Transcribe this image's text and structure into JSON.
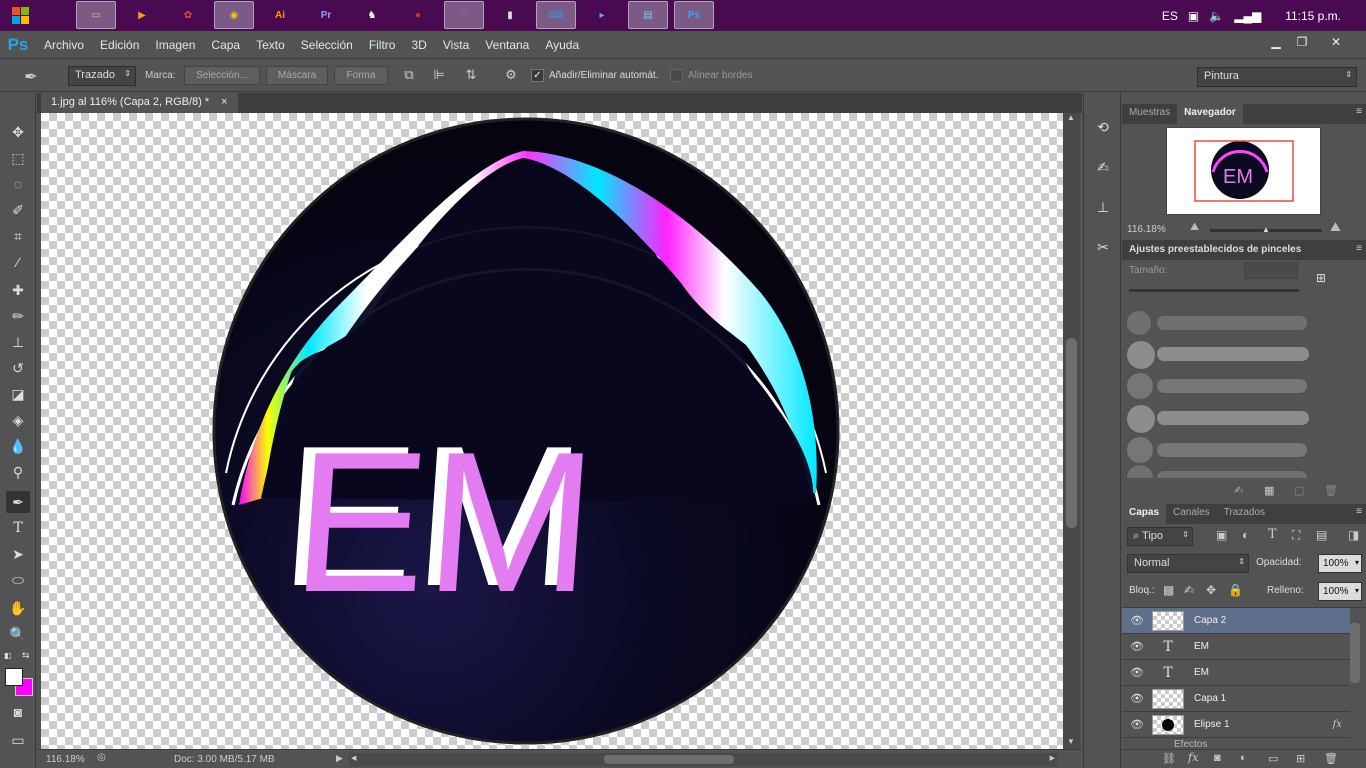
{
  "taskbar": {
    "tray": {
      "lang": "ES",
      "time": "11:15 p.m."
    },
    "apps": [
      {
        "icon": "file-explorer-icon",
        "glyph": "▭",
        "color": "#e8c36a"
      },
      {
        "icon": "media-player-icon",
        "glyph": "▶",
        "color": "#f39c12"
      },
      {
        "icon": "paint-brain-icon",
        "glyph": "✿",
        "color": "#e74c3c"
      },
      {
        "icon": "chrome-icon",
        "glyph": "◉",
        "color": "#f1c40f"
      },
      {
        "icon": "illustrator-icon",
        "glyph": "Ai",
        "color": "#ff9a00"
      },
      {
        "icon": "premiere-icon",
        "glyph": "Pr",
        "color": "#9999ff"
      },
      {
        "icon": "game-figure-icon",
        "glyph": "♞",
        "color": "#ffffff"
      },
      {
        "icon": "record-icon",
        "glyph": "●",
        "color": "#c0392b"
      },
      {
        "icon": "paint-palette-icon",
        "glyph": "✎",
        "color": "#9b59b6"
      },
      {
        "icon": "usb-icon",
        "glyph": "▮",
        "color": "#dddddd"
      },
      {
        "icon": "keyboard-icon",
        "glyph": "⌨",
        "color": "#3498db"
      },
      {
        "icon": "cmd-icon",
        "glyph": "▸",
        "color": "#5dade2"
      },
      {
        "icon": "notepad-icon",
        "glyph": "▤",
        "color": "#85c1e9"
      },
      {
        "icon": "photoshop-icon",
        "glyph": "Ps",
        "color": "#31a8ff"
      }
    ]
  },
  "app": {
    "logo": "Ps"
  },
  "menu": [
    "Archivo",
    "Edición",
    "Imagen",
    "Capa",
    "Texto",
    "Selección",
    "Filtro",
    "3D",
    "Vista",
    "Ventana",
    "Ayuda"
  ],
  "options": {
    "mode": "Trazado",
    "marca_label": "Marca:",
    "seleccion": "Selección...",
    "mascara": "Máscara",
    "forma": "Forma",
    "add_remove": "Añadir/Eliminar automát.",
    "align_edges": "Alinear bordes",
    "workspace": "Pintura"
  },
  "document": {
    "tab_title": "1.jpg al 116% (Capa 2, RGB/8) *",
    "close": "×",
    "logo_text": "EM",
    "zoom": "116.18%",
    "doc_info": "Doc: 3.00 MB/5.17 MB"
  },
  "colors": {
    "foreground": "#ffffff",
    "background": "#ff00ff",
    "accent_pink": "#e37cf0"
  },
  "navigator": {
    "tabs": [
      "Muestras",
      "Navegador"
    ],
    "active_tab": "Navegador",
    "zoom": "116.18%",
    "thumb_text": "EM"
  },
  "brush_presets": {
    "title": "Ajustes preestablecidos de pinceles",
    "size_label": "Tamaño:"
  },
  "layers_panel": {
    "tabs": [
      "Capas",
      "Canales",
      "Trazados"
    ],
    "active_tab": "Capas",
    "filter": "Tipo",
    "blend_mode": "Normal",
    "opacity_label": "Opacidad:",
    "opacity": "100%",
    "lock_label": "Bloq.:",
    "fill_label": "Relleno:",
    "fill": "100%",
    "layers": [
      {
        "name": "Capa 2",
        "kind": "raster",
        "selected": true
      },
      {
        "name": "EM",
        "kind": "text",
        "selected": false
      },
      {
        "name": "EM",
        "kind": "text",
        "selected": false
      },
      {
        "name": "Capa 1",
        "kind": "raster",
        "selected": false
      },
      {
        "name": "Elipse 1",
        "kind": "shape",
        "selected": false,
        "fx": "fx"
      }
    ],
    "effects_label": "Efectos"
  }
}
